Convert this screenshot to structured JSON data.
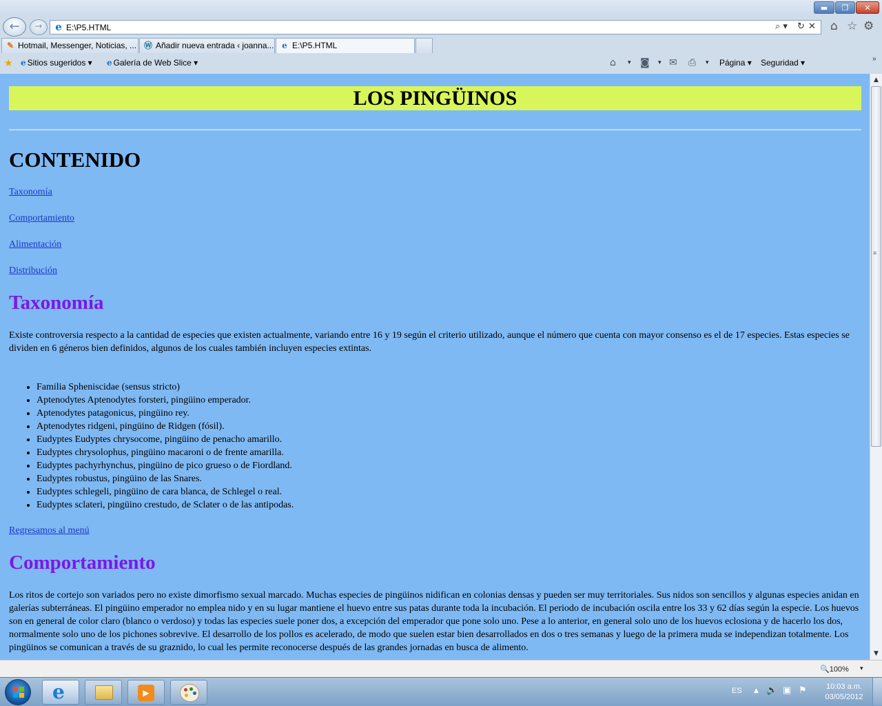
{
  "browser": {
    "address": "E:\\P5.HTML",
    "window_controls": {
      "minimize": "▬",
      "maximize": "❐",
      "close": "✕"
    },
    "nav": {
      "back": "←",
      "forward": "→"
    },
    "address_tools": {
      "search": "⌕ ▾",
      "refresh": "↻",
      "stop": "✕"
    },
    "top_icons": {
      "home": "⌂",
      "favorites": "☆",
      "tools": "⚙"
    },
    "tabs": [
      {
        "label": "Hotmail, Messenger, Noticias, ...",
        "icon": "✎"
      },
      {
        "label": "Añadir nueva entrada ‹ joanna...",
        "icon": "Ⓦ"
      },
      {
        "label": "E:\\P5.HTML",
        "icon": "e"
      }
    ],
    "tab_close": "✕",
    "favorites_bar": {
      "star_icon": "★",
      "suggested_sites": "Sitios sugeridos ▾",
      "web_slice_gallery": "Galería de Web Slice ▾"
    },
    "command_bar": {
      "home_icon": "⌂",
      "feeds_icon": "◙",
      "mail_icon": "✉",
      "print_icon": "⎙",
      "dropdown": "▾",
      "page": "Página ▾",
      "safety": "Seguridad ▾",
      "overflow": "»"
    },
    "status": {
      "zoom": "🔍100%",
      "zoom_dropdown": "▾"
    }
  },
  "page": {
    "title": "LOS PINGÜINOS",
    "contents_heading": "CONTENIDO",
    "toc": [
      "Taxonomía",
      "Comportamiento",
      "Alimentación",
      "Distribución"
    ],
    "sections": {
      "taxonomia": {
        "heading": "Taxonomía",
        "text": "Existe controversia respecto a la cantidad de especies que existen actualmente, variando entre 16 y 19 según el criterio utilizado, aunque el número que cuenta con mayor consenso es el de 17 especies. Estas especies se dividen en 6 géneros bien definidos, algunos de los cuales también incluyen especies extintas.",
        "species": [
          "Familia Spheniscidae (sensus stricto)",
          "Aptenodytes Aptenodytes forsteri, pingüino emperador.",
          "Aptenodytes patagonicus, pingüino rey.",
          "Aptenodytes ridgeni, pingüino de Ridgen (fósil).",
          "Eudyptes Eudyptes chrysocome, pingüino de penacho amarillo.",
          "Eudyptes chrysolophus, pingüino macaroni o de frente amarilla.",
          "Eudyptes pachyrhynchus, pingüino de pico grueso o de Fiordland.",
          "Eudyptes robustus, pingüino de las Snares.",
          "Eudyptes schlegeli, pingüino de cara blanca, de Schlegel o real.",
          "Eudyptes sclateri, pingüino crestudo, de Sclater o de las antipodas."
        ],
        "back_link": "Regresamos al menú"
      },
      "comportamiento": {
        "heading": "Comportamiento",
        "text": "Los ritos de cortejo son variados pero no existe dimorfismo sexual marcado. Muchas especies de pingüinos nidifican en colonias densas y pueden ser muy territoriales. Sus nidos son sencillos y algunas especies anidan en galerías subterráneas. El pingüino emperador no emplea nido y en su lugar mantiene el huevo entre sus patas durante toda la incubación. El periodo de incubación oscila entre los 33 y 62 días según la especie. Los huevos son en general de color claro (blanco o verdoso) y todas las especies suele poner dos, a excepción del emperador que pone solo uno. Pese a lo anterior, en general solo uno de los huevos eclosiona y de hacerlo los dos, normalmente solo uno de los pichones sobrevive. El desarrollo de los pollos es acelerado, de modo que suelen estar bien desarrollados en dos o tres semanas y luego de la primera muda se independizan totalmente. Los pingüinos se comunican a través de su graznido, lo cual les permite reconocerse después de las grandes jornadas en busca de alimento."
      }
    }
  },
  "scrollbar": {
    "up": "▲",
    "down": "▼",
    "grip": "≡"
  },
  "taskbar": {
    "tray_up": "▲",
    "volume": "🔊",
    "network": "▣",
    "flag": "⚑",
    "language": "ES",
    "time": "10:03 a.m.",
    "date": "03/05/2012",
    "media_play": "▶"
  },
  "colors": {
    "page_background": "#7fb9f3",
    "banner": "#d8f55a",
    "section_heading": "#7b18e8",
    "link": "#1a37c6"
  }
}
